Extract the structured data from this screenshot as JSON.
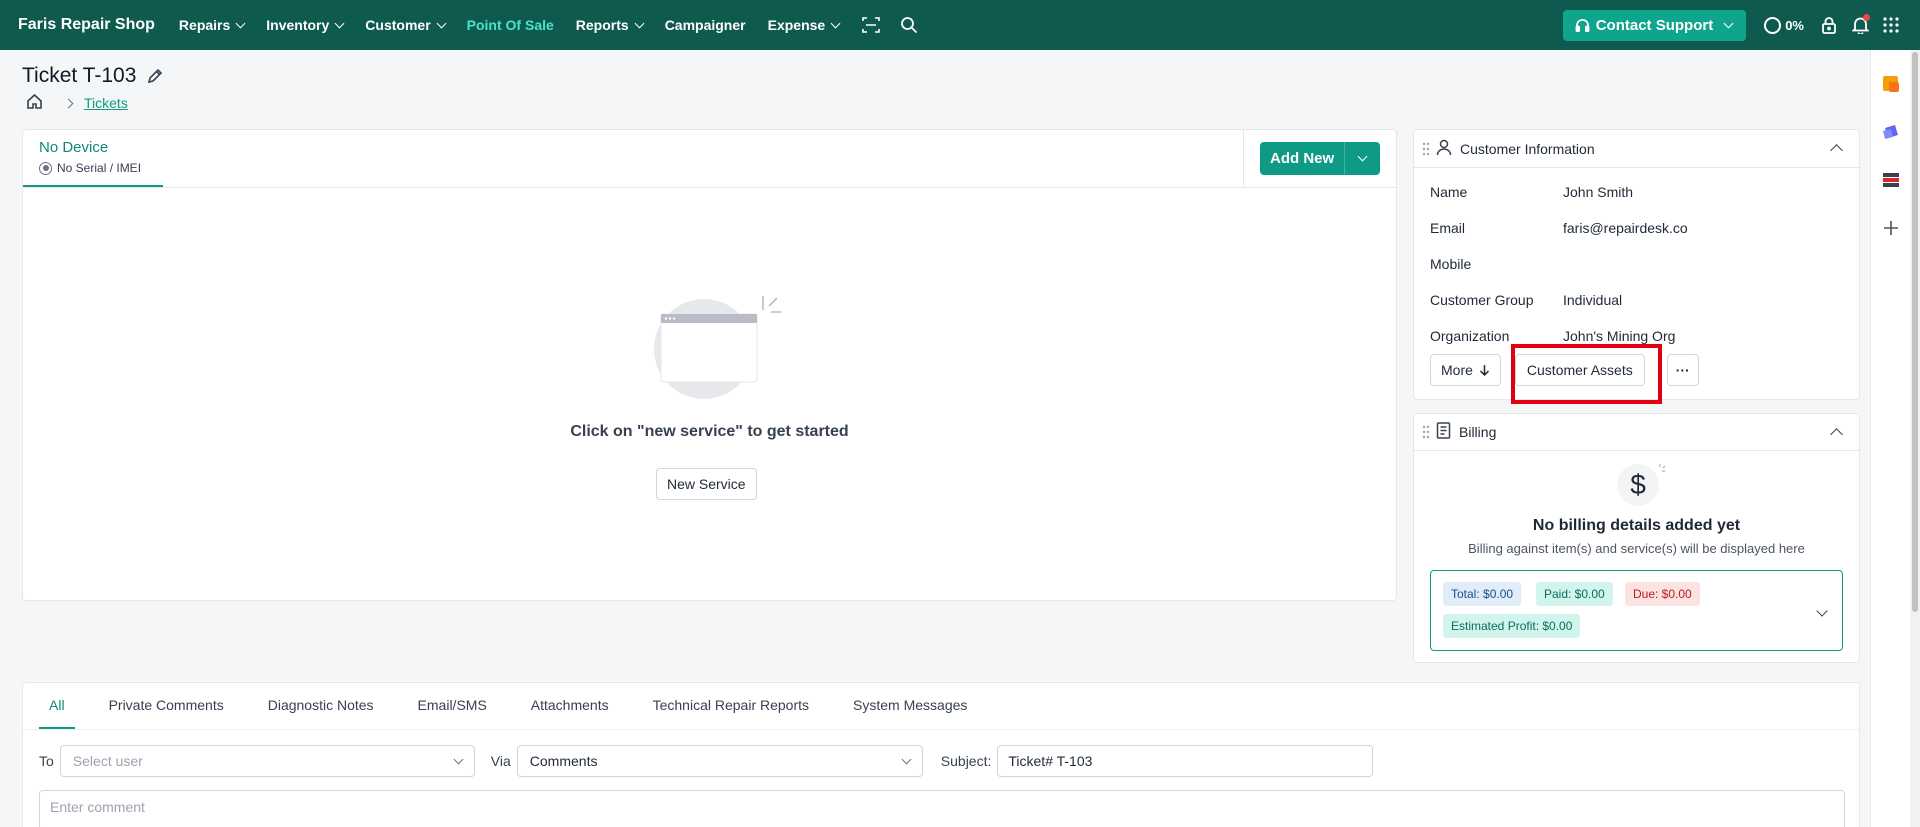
{
  "nav": {
    "brand": "Faris Repair Shop",
    "items": [
      {
        "label": "Repairs",
        "dropdown": true,
        "active": false
      },
      {
        "label": "Inventory",
        "dropdown": true,
        "active": false
      },
      {
        "label": "Customer",
        "dropdown": true,
        "active": false
      },
      {
        "label": "Point Of Sale",
        "dropdown": false,
        "active": true
      },
      {
        "label": "Reports",
        "dropdown": true,
        "active": false
      },
      {
        "label": "Campaigner",
        "dropdown": false,
        "active": false
      },
      {
        "label": "Expense",
        "dropdown": true,
        "active": false
      }
    ],
    "support_label": "Contact Support",
    "progress_text": "0%",
    "icons": [
      "scan-icon",
      "search-icon",
      "headset-icon",
      "lock-icon",
      "bell-icon",
      "apps-grid-icon"
    ]
  },
  "page": {
    "title": "Ticket T-103",
    "breadcrumb": {
      "current": "Tickets"
    }
  },
  "device": {
    "tab_title": "No Device",
    "tab_sub": "No Serial / IMEI",
    "add_new_label": "Add New",
    "empty_text": "Click on \"new service\" to get started",
    "new_service_label": "New Service"
  },
  "customer": {
    "title": "Customer Information",
    "fields": [
      {
        "key": "Name",
        "value": "John Smith"
      },
      {
        "key": "Email",
        "value": "faris@repairdesk.co"
      },
      {
        "key": "Mobile",
        "value": ""
      },
      {
        "key": "Customer Group",
        "value": "Individual"
      },
      {
        "key": "Organization",
        "value": "John's Mining Org"
      }
    ],
    "more_label": "More",
    "assets_label": "Customer Assets",
    "ellipsis_label": "···"
  },
  "billing": {
    "title": "Billing",
    "empty_title": "No billing details added yet",
    "empty_sub": "Billing against item(s) and service(s) will be displayed here",
    "total": "Total: $0.00",
    "paid": "Paid: $0.00",
    "due": "Due: $0.00",
    "profit": "Estimated Profit: $0.00"
  },
  "comments": {
    "tabs": [
      "All",
      "Private Comments",
      "Diagnostic Notes",
      "Email/SMS",
      "Attachments",
      "Technical Repair Reports",
      "System Messages"
    ],
    "active_tab": 0,
    "to_label": "To",
    "to_placeholder": "Select user",
    "via_label": "Via",
    "via_value": "Comments",
    "subject_label": "Subject:",
    "subject_value": "Ticket# T-103",
    "comment_placeholder": "Enter comment"
  },
  "colors": {
    "nav_bg": "#0e5a4f",
    "accent": "#0e9a84",
    "active_nav": "#4ee2c4",
    "highlight": "#e00010"
  }
}
